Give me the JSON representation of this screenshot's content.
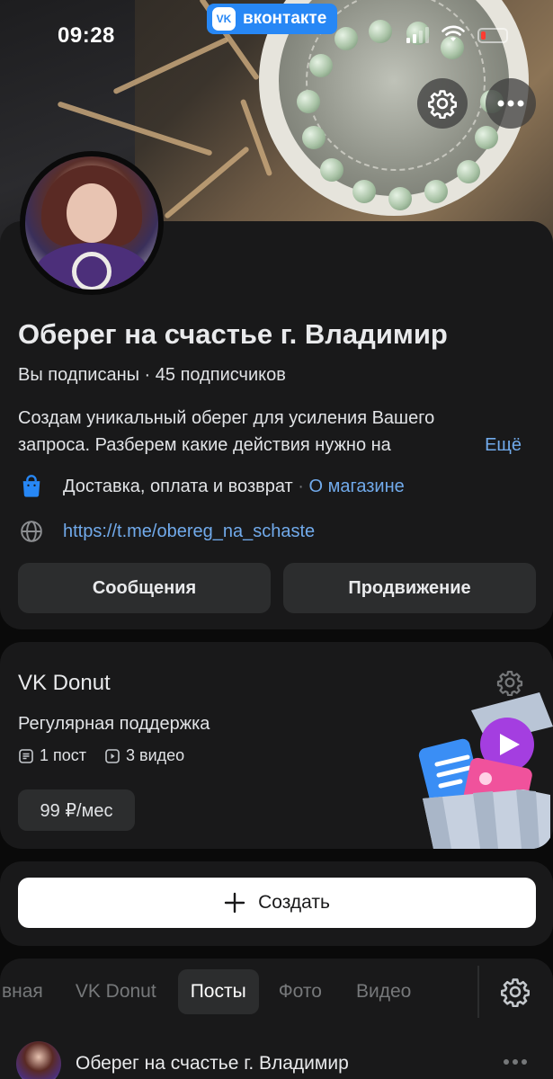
{
  "status_bar": {
    "time": "09:28",
    "app_badge": "вконтакте",
    "app_logo": "VK"
  },
  "cover": {
    "settings_icon": "gear-icon",
    "more_icon": "more-horizontal-icon"
  },
  "profile": {
    "name": "Оберег на счастье г. Владимир",
    "subscribed": "Вы подписаны · 45 подписчиков",
    "description_line1": "Создам уникальный оберег для усиления Вашего",
    "description_line2": "запроса. Разберем какие действия нужно на",
    "more_label": "Ещё",
    "shop_info": "Доставка, оплата и возврат",
    "shop_separator": " · ",
    "shop_about": "О магазине",
    "link": "https://t.me/obereg_na_schaste",
    "messages_button": "Сообщения",
    "promotion_button": "Продвижение"
  },
  "donut": {
    "title": "VK Donut",
    "subtitle": "Регулярная поддержка",
    "posts_count": "1 пост",
    "videos_count": "3 видео",
    "price": "99 ₽/мес"
  },
  "create": {
    "label": "Создать"
  },
  "tabs": {
    "items": [
      {
        "label": "вная"
      },
      {
        "label": "VK Donut"
      },
      {
        "label": "Посты"
      },
      {
        "label": "Фото"
      },
      {
        "label": "Видео"
      }
    ],
    "active": "Посты"
  },
  "post": {
    "author": "Оберег на счастье г. Владимир"
  },
  "colors": {
    "accent": "#2787f5",
    "link": "#71aaeb",
    "card": "#19191a",
    "background": "#0a0a0a"
  }
}
